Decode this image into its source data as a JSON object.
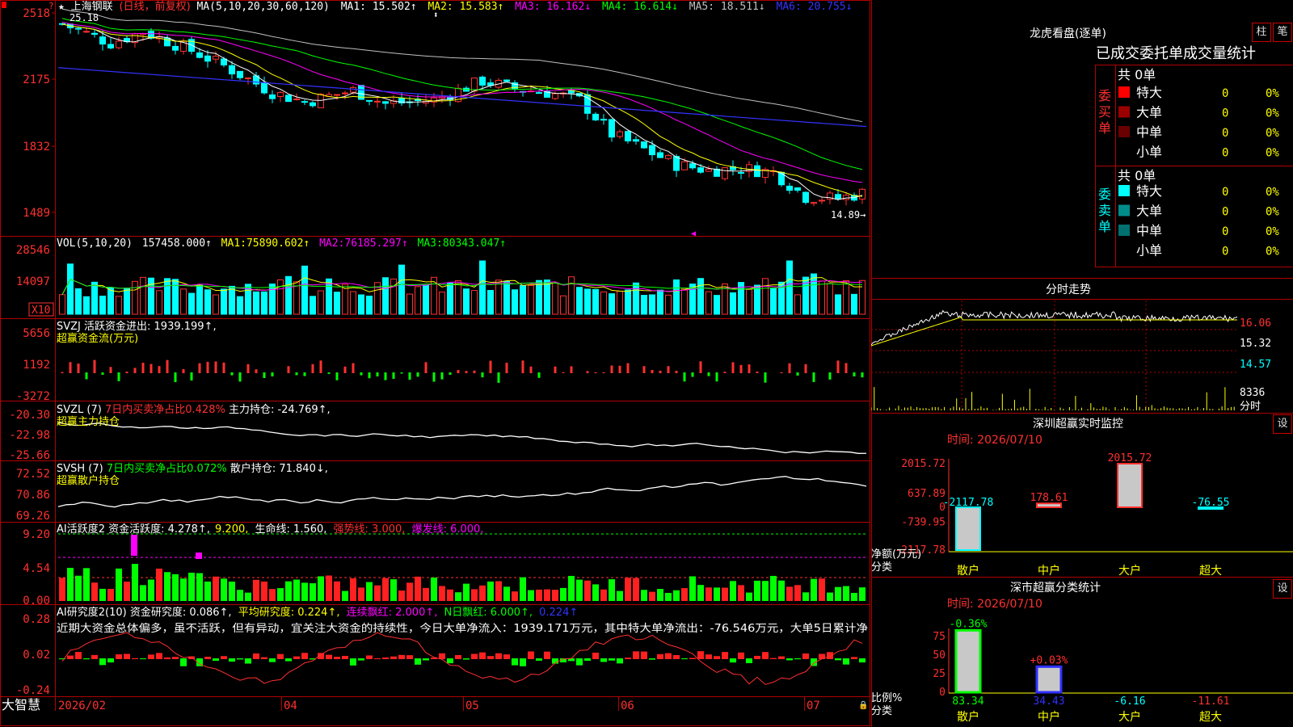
{
  "app": {
    "name": "大智慧"
  },
  "main": {
    "stock_name": "上海钢联",
    "period": "(日线，前复权)",
    "ma_label": "MA(5,10,20,30,60,120)",
    "ma": [
      {
        "label": "MA1:",
        "value": "15.502↑",
        "color": "#ffffff"
      },
      {
        "label": "MA2:",
        "value": "15.583↑",
        "color": "#ffff00"
      },
      {
        "label": "MA3:",
        "value": "16.162↓",
        "color": "#ff00ff"
      },
      {
        "label": "MA4:",
        "value": "16.614↓",
        "color": "#00ff00"
      },
      {
        "label": "MA5:",
        "value": "18.511↓",
        "color": "#c0c0c0"
      },
      {
        "label": "MA6:",
        "value": "20.755↓",
        "color": "#3333ff"
      }
    ],
    "high_label": "25.18",
    "low_label": "14.89→",
    "price_ticks": [
      "2518",
      "2175",
      "1832",
      "1489"
    ]
  },
  "vol": {
    "label": "VOL(5,10,20)",
    "value": "157458.000↑",
    "ma": [
      {
        "label": "MA1:",
        "value": "75890.602↑",
        "color": "#ffff00"
      },
      {
        "label": "MA2:",
        "value": "76185.297↑",
        "color": "#ff00ff"
      },
      {
        "label": "MA3:",
        "value": "80343.047↑",
        "color": "#00ff00"
      }
    ],
    "ticks": [
      "28546",
      "14097"
    ],
    "unit": "X10"
  },
  "svzj": {
    "title": "SVZJ  活跃资金进出: 1939.199↑,",
    "sub": "超赢资金流(万元)",
    "ticks": [
      "5656",
      "1192",
      "-3272"
    ]
  },
  "svzl": {
    "title": "SVZL (7) ",
    "title_red": "7日内买卖净占比0.428%",
    "title_end": " 主力持仓: -24.769↑,",
    "sub": "超赢主力持仓",
    "ticks": [
      "-20.30",
      "-22.98",
      "-25.66"
    ]
  },
  "svsh": {
    "title": "SVSH (7) ",
    "title_green": "7日内买卖净占比0.072%",
    "title_end": " 散户持仓: 71.840↓,",
    "sub": "超赢散户持仓",
    "ticks": [
      "72.52",
      "70.86",
      "69.26"
    ]
  },
  "ai_active": {
    "title": "AI活跃度2 资金活跃度: 4.278↑,",
    "items": [
      {
        "text": "9.200,",
        "color": "#ffff00"
      },
      {
        "text": "生命线: 1.560,",
        "color": "#ffffff"
      },
      {
        "text": "强势线: 3.000,",
        "color": "#ff3030"
      },
      {
        "text": "爆发线: 6.000,",
        "color": "#ff00ff"
      }
    ],
    "ticks": [
      "9.20",
      "4.54",
      "0.00"
    ]
  },
  "ai_research": {
    "title": "AI研究度2(10) 资金研究度: 0.086↑,",
    "items": [
      {
        "text": "平均研究度: 0.224↑,",
        "color": "#ffff00"
      },
      {
        "text": "连续飘红: 2.000↑,",
        "color": "#ff00ff"
      },
      {
        "text": "N日飘红: 6.000↑,",
        "color": "#00ff00"
      },
      {
        "text": "0.224↑",
        "color": "#3333ff"
      }
    ],
    "comment": "近期大资金总体偏多，虽不活跃，但有异动，宜关注大资金的持续性，今日大单净流入：1939.171万元，其中特大单净流出：-76.546万元，大单5日累计净",
    "ticks": [
      "0.28",
      "0.02",
      "-0.24"
    ]
  },
  "date_axis": [
    "2026/02",
    "04",
    "05",
    "06",
    "07"
  ],
  "right": {
    "lhb_title": "龙虎看盘(逐单)",
    "btn_zhu": "柱",
    "btn_bi": "笔",
    "order_stats_title": "已成交委托单成交量统计",
    "buy_label": "委买单",
    "sell_label": "委卖单",
    "buy_total": "共 0单",
    "sell_total": "共 0单",
    "buy_rows": [
      {
        "name": "特大",
        "count": "0",
        "pct": "0%",
        "color": "#ff0000"
      },
      {
        "name": "大单",
        "count": "0",
        "pct": "0%",
        "color": "#9b0000"
      },
      {
        "name": "中单",
        "count": "0",
        "pct": "0%",
        "color": "#6a0000"
      },
      {
        "name": "小单",
        "count": "0",
        "pct": "0%",
        "color": "#000000"
      }
    ],
    "sell_rows": [
      {
        "name": "特大",
        "count": "0",
        "pct": "0%",
        "color": "#00ffff"
      },
      {
        "name": "大单",
        "count": "0",
        "pct": "0%",
        "color": "#008b8b"
      },
      {
        "name": "中单",
        "count": "0",
        "pct": "0%",
        "color": "#007070"
      },
      {
        "name": "小单",
        "count": "0",
        "pct": "0%",
        "color": "#000000"
      }
    ],
    "intraday_title": "分时走势",
    "intraday_ticks": [
      "16.06",
      "15.32",
      "14.57"
    ],
    "intraday_vol": "8336",
    "intraday_vol_label": "分时",
    "sz_monitor_title": "深圳超赢实时监控",
    "sz_monitor_time": "时间: 2026/07/10",
    "sz_monitor_ticks": [
      "2015.72",
      "637.89",
      "0",
      "-739.95",
      "-2117.78"
    ],
    "sz_monitor_bars": [
      {
        "label": "散户",
        "value": -2117.78,
        "text": "-2117.78",
        "color": "#00ffff"
      },
      {
        "label": "中户",
        "value": 178.61,
        "text": "178.61",
        "color": "#ff3030"
      },
      {
        "label": "大户",
        "value": 2015.72,
        "text": "2015.72",
        "color": "#ff3030"
      },
      {
        "label": "超大",
        "value": -76.55,
        "text": "-76.55",
        "color": "#00ffff"
      }
    ],
    "sz_monitor_axis_label": "净额(万元)",
    "sz_monitor_class_label": "分类",
    "set_label": "设",
    "sz_class_title": "深市超赢分类统计",
    "sz_class_time": "时间: 2026/07/10",
    "sz_class_ticks": [
      "75",
      "50",
      "25",
      "0"
    ],
    "sz_class_bars": [
      {
        "label": "散户",
        "value": 83.34,
        "pct": "-0.36%",
        "bottom": "83.34",
        "pct_color": "#00ff00",
        "bottom_color": "#00ff00"
      },
      {
        "label": "中户",
        "value": 34.43,
        "pct": "+0.03%",
        "bottom": "34.43",
        "pct_color": "#ff3030",
        "bottom_color": "#3030ff"
      },
      {
        "label": "大户",
        "value": 0,
        "pct": "",
        "bottom": "-6.16",
        "pct_color": "#ff3030",
        "bottom_color": "#00ffff"
      },
      {
        "label": "超大",
        "value": 0,
        "pct": "",
        "bottom": "-11.61",
        "pct_color": "#ff3030",
        "bottom_color": "#ff3030"
      }
    ],
    "sz_class_axis_label": "比例%",
    "sz_class_class_label": "分类"
  }
}
